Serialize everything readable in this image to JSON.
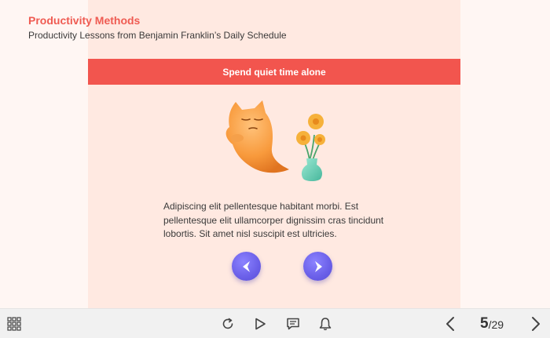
{
  "header": {
    "title": "Productivity Methods",
    "subtitle": "Productivity Lessons from Benjamin Franklin’s Daily Schedule"
  },
  "slide": {
    "banner_title": "Spend quiet time alone",
    "body_text": "Adipiscing elit pellentesque habitant morbi. Est pellentesque elit ullamcorper dignissim cras tincidunt lobortis. Sit amet nisl suscipit est ultricies.",
    "illustration_icons": [
      "ghost-character-icon",
      "flower-vase-icon"
    ]
  },
  "slide_nav": {
    "prev_icon": "chevron-left-icon",
    "next_icon": "chevron-right-icon"
  },
  "toolbar": {
    "icons": [
      "grid-menu-icon",
      "replay-icon",
      "play-icon",
      "comment-icon",
      "bell-icon",
      "prev-arrow-icon",
      "next-arrow-icon"
    ],
    "page_current": "5",
    "page_total": "/29"
  },
  "colors": {
    "accent": "#f2554e",
    "title": "#ef5b52",
    "panel_bg": "#ffe9e1",
    "page_bg": "#fff6f3",
    "nav_button": "#6a5fe8",
    "toolbar_bg": "#f1f1f1"
  }
}
